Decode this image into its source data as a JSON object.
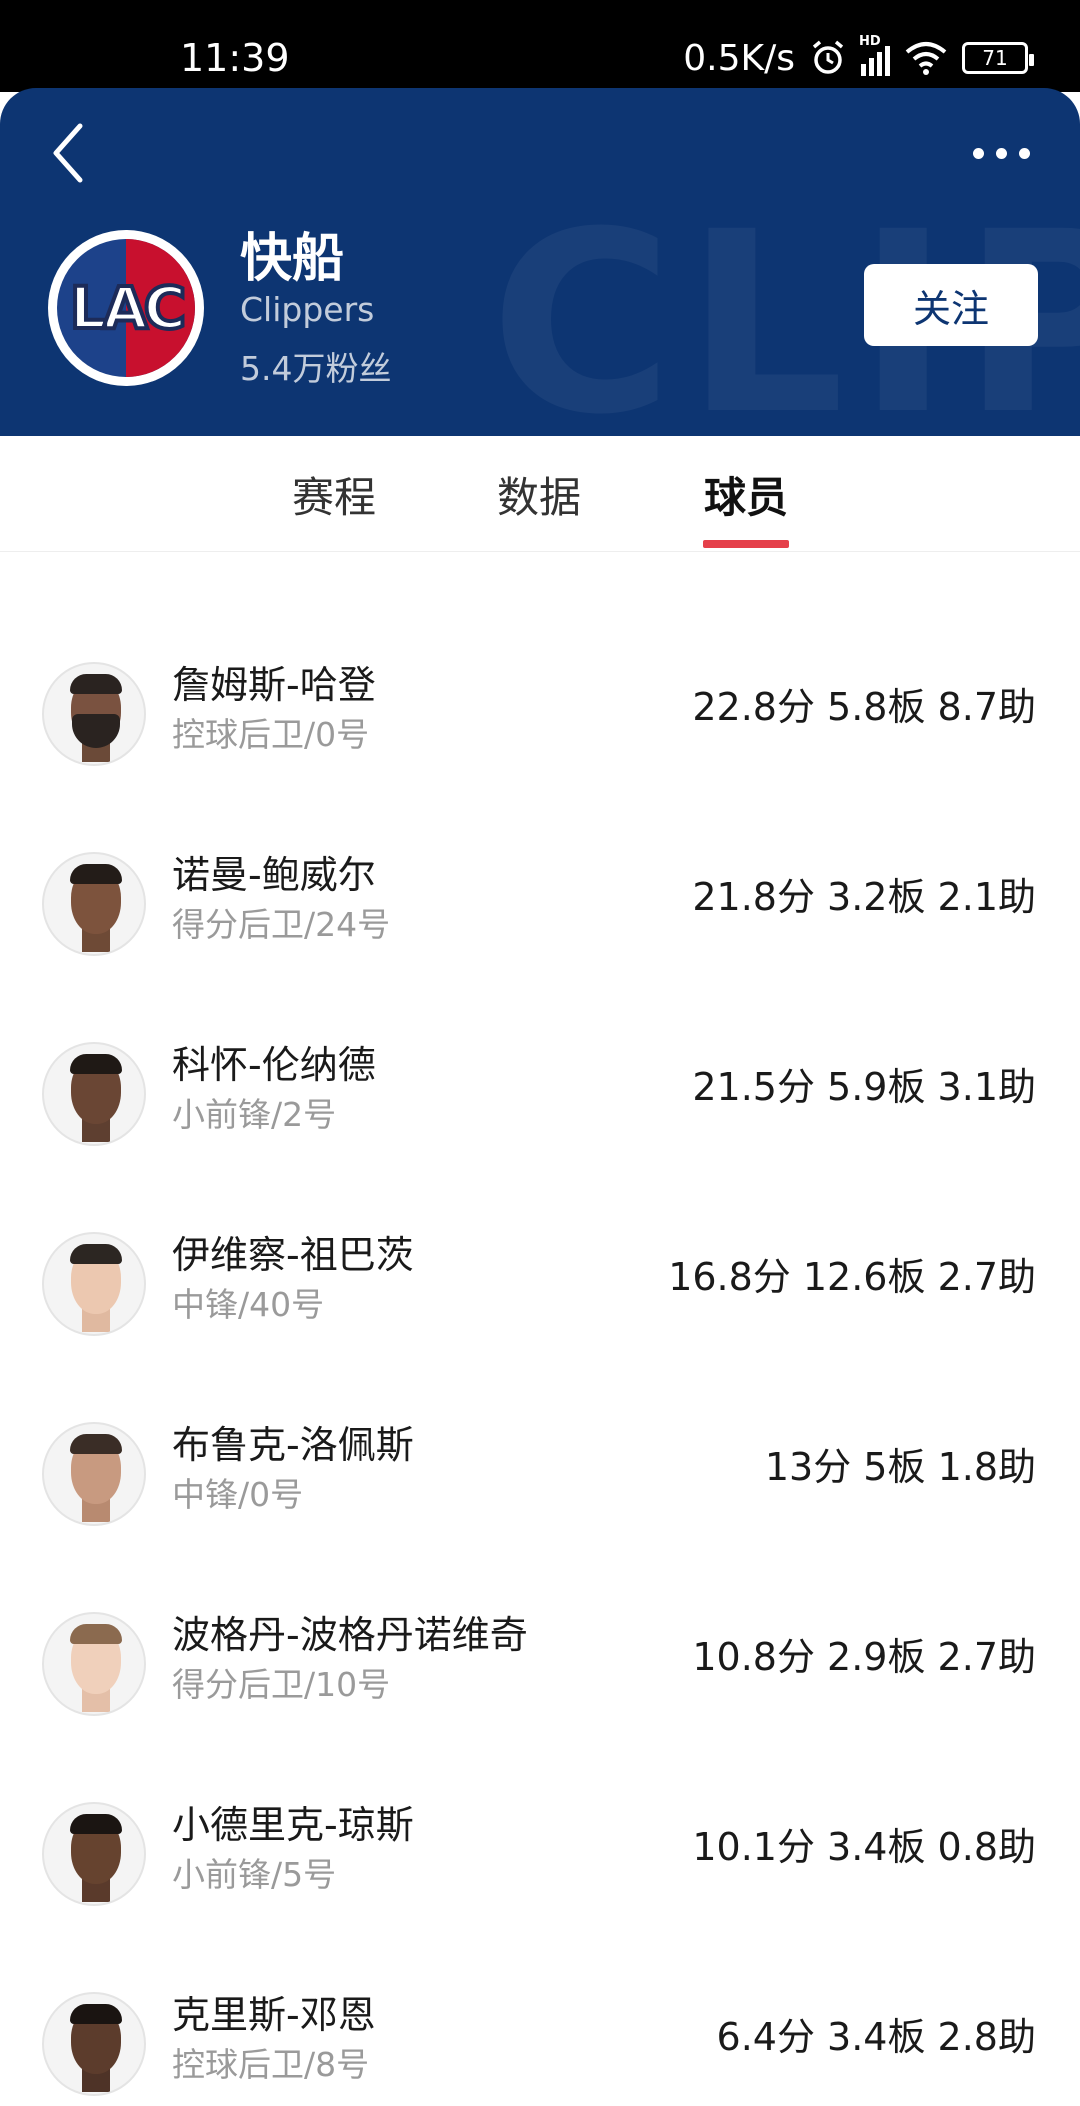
{
  "status_bar": {
    "time": "11:39",
    "network_speed": "0.5K/s",
    "network_type": "HD",
    "battery": "71"
  },
  "header": {
    "team_name": "快船",
    "team_name_en": "Clippers",
    "fans": "5.4万粉丝",
    "follow_label": "关注",
    "logo_text": "LAC",
    "watermark": "CLIPPERS",
    "colors": {
      "header_bg": "#0d3572",
      "logo_blue": "#1d428a",
      "logo_red": "#c8102e"
    }
  },
  "tabs": [
    {
      "label": "赛程",
      "active": false
    },
    {
      "label": "数据",
      "active": false
    },
    {
      "label": "球员",
      "active": true
    }
  ],
  "accent_color": "#e5404a",
  "players": [
    {
      "name": "詹姆斯-哈登",
      "info": "控球后卫/0号",
      "stats": "22.8分 5.8板 8.7助"
    },
    {
      "name": "诺曼-鲍威尔",
      "info": "得分后卫/24号",
      "stats": "21.8分 3.2板 2.1助"
    },
    {
      "name": "科怀-伦纳德",
      "info": "小前锋/2号",
      "stats": "21.5分 5.9板 3.1助"
    },
    {
      "name": "伊维察-祖巴茨",
      "info": "中锋/40号",
      "stats": "16.8分 12.6板 2.7助"
    },
    {
      "name": "布鲁克-洛佩斯",
      "info": "中锋/0号",
      "stats": "13分 5板 1.8助"
    },
    {
      "name": "波格丹-波格丹诺维奇",
      "info": "得分后卫/10号",
      "stats": "10.8分 2.9板 2.7助"
    },
    {
      "name": "小德里克-琼斯",
      "info": "小前锋/5号",
      "stats": "10.1分 3.4板 0.8助"
    },
    {
      "name": "克里斯-邓恩",
      "info": "控球后卫/8号",
      "stats": "6.4分 3.4板 2.8助"
    }
  ]
}
